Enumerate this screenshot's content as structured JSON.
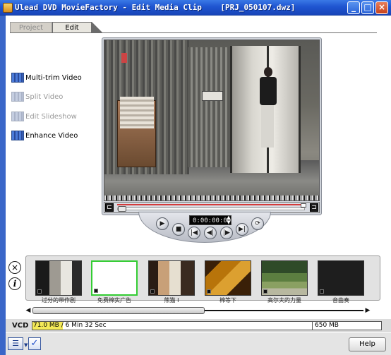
{
  "window": {
    "title": "Ulead DVD MovieFactory - Edit Media Clip    [PRJ_050107.dwz]",
    "minimize": "_",
    "maximize": "□",
    "close": "×"
  },
  "tabs": [
    {
      "label": "Project",
      "active": false
    },
    {
      "label": "Edit",
      "active": true
    }
  ],
  "menu": [
    {
      "label": "Multi-trim Video",
      "enabled": true
    },
    {
      "label": "Split Video",
      "enabled": false
    },
    {
      "label": "Edit Slideshow",
      "enabled": false
    },
    {
      "label": "Enhance Video",
      "enabled": true
    }
  ],
  "player": {
    "timecode": "0:00:00:00",
    "trim_start_icon": "⊏",
    "trim_end_icon": "⊐",
    "spin_up": "▲",
    "spin_down": "▼"
  },
  "controls": {
    "play": "▶",
    "stop": "■",
    "home": "|◀",
    "prev": "◀|",
    "next": "|▶",
    "end": "▶|",
    "repeat": "⟳"
  },
  "side_buttons": {
    "delete": "×",
    "info": "i"
  },
  "clips": [
    {
      "label": "过分的带作剧",
      "selected": false
    },
    {
      "label": "免费棉实广告",
      "selected": true
    },
    {
      "label": "熊猫 I",
      "selected": false
    },
    {
      "label": "棉等下",
      "selected": false
    },
    {
      "label": "高尔夫的力量",
      "selected": false
    },
    {
      "label": "音曲奏",
      "selected": false
    }
  ],
  "scroll": {
    "left": "◀",
    "right": "▶"
  },
  "disc": {
    "type": "VCD",
    "used_text": "71.0 MB / 6 Min 32 Sec",
    "used_fraction": 0.11,
    "capacity": "650 MB",
    "fill_color": "#f4ea58"
  },
  "bottom": {
    "list_icon": "☰",
    "dropdown": "▼",
    "check": "✓",
    "help": "Help"
  }
}
